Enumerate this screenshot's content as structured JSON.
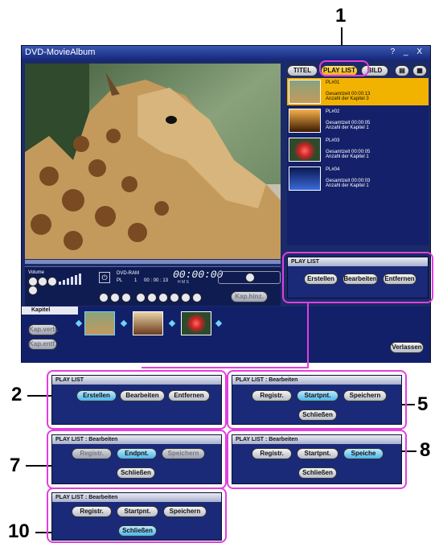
{
  "app": {
    "title": "DVD-MovieAlbum",
    "window_controls": "? _ X"
  },
  "callouts": [
    "1",
    "2",
    "5",
    "7",
    "8",
    "10"
  ],
  "tabs": {
    "titel": "TITEL",
    "playlist": "PLAY LIST",
    "bild": "BILD"
  },
  "playlist": [
    {
      "name": "PL#01",
      "line1": "Gesamtzeit 00:00:13",
      "line2": "Anzahl der Kapitel  3",
      "selected": true
    },
    {
      "name": "PL#02",
      "line1": "Gesamtzeit 00:00:05",
      "line2": "Anzahl der Kapitel  1",
      "selected": false
    },
    {
      "name": "PL#03",
      "line1": "Gesamtzeit 00:00:05",
      "line2": "Anzahl der Kapitel  1",
      "selected": false
    },
    {
      "name": "PL#04",
      "line1": "Gesamtzeit 00:00:03",
      "line2": "Anzahl der Kapitel  1",
      "selected": false
    }
  ],
  "controls": {
    "volume_label": "Volume",
    "media": "DVD-RAM",
    "pl_label": "PL",
    "pl_num": "1",
    "time_small": "00 : 00 : 13",
    "time_units": "H    M    S",
    "time_big": "00:00:00",
    "rec_btn": "Kap.hinz."
  },
  "playlist_panel": {
    "header": "PLAY LIST",
    "create": "Erstellen",
    "edit": "Bearbeiten",
    "remove": "Entfernen"
  },
  "chapters": {
    "header": "Kapitel",
    "btn1": "Kap.verb.",
    "btn2": "Kap.entf.",
    "exit": "Verlassen"
  },
  "detail": {
    "p2": {
      "header": "PLAY LIST",
      "create": "Erstellen",
      "edit": "Bearbeiten",
      "remove": "Entfernen"
    },
    "p5": {
      "header": "PLAY LIST : Bearbeiten",
      "registr": "Registr.",
      "startpnt": "Startpnt.",
      "save": "Speichern",
      "close": "Schließen"
    },
    "p7": {
      "header": "PLAY LIST : Bearbeiten",
      "registr": "Registr.",
      "endpnt": "Endpnt.",
      "save": "Speichern",
      "close": "Schließen"
    },
    "p8": {
      "header": "PLAY LIST : Bearbeiten",
      "registr": "Registr.",
      "startpnt": "Startpnt.",
      "save": "Speiche",
      "close": "Schließen"
    },
    "p10": {
      "header": "PLAY LIST : Bearbeiten",
      "registr": "Registr.",
      "startpnt": "Startpnt.",
      "save": "Speichern",
      "close": "Schließen"
    }
  },
  "colors": {
    "app_bg": "#1b2a68",
    "selected": "#f2b200",
    "callout_border": "#e23ee0",
    "highlight_btn": "#4eb6e6"
  }
}
